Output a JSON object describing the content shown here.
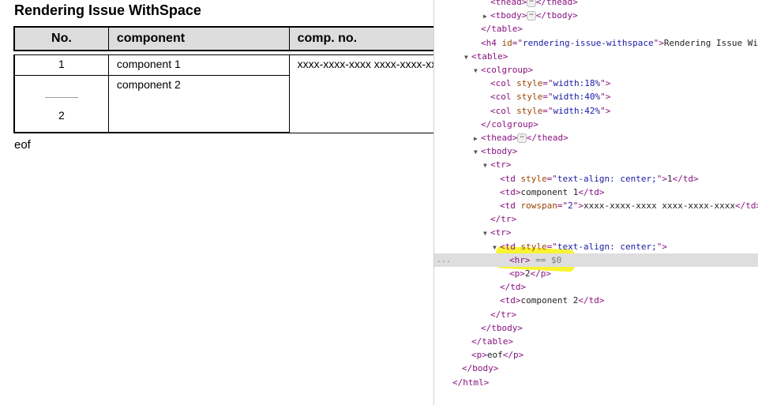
{
  "page": {
    "heading": "Rendering Issue WithSpace",
    "table": {
      "headers": [
        "No.",
        "component",
        "comp. no."
      ],
      "rows": [
        {
          "no": "1",
          "component": "component 1",
          "comp_no": "xxxx-xxxx-xxxx xxxx-xxxx-xxxx"
        },
        {
          "no": "2",
          "component": "component 2"
        }
      ]
    },
    "footer_text": "eof"
  },
  "devtools": {
    "lines": [
      {
        "indent": 3,
        "toggle": "",
        "parts": [
          [
            "tag",
            "<thead>"
          ],
          [
            "ellip",
            "⋯"
          ],
          [
            "tag",
            "</thead>"
          ]
        ],
        "partial": true
      },
      {
        "indent": 3,
        "toggle": "▶",
        "parts": [
          [
            "tag",
            "<tbody>"
          ],
          [
            "ellip",
            "⋯"
          ],
          [
            "tag",
            "</tbody>"
          ]
        ]
      },
      {
        "indent": 2,
        "toggle": "",
        "parts": [
          [
            "tag",
            "</table>"
          ]
        ]
      },
      {
        "indent": 2,
        "toggle": "",
        "parts": [
          [
            "tag",
            "<h4 "
          ],
          [
            "attr",
            "id"
          ],
          [
            "tag",
            "=\""
          ],
          [
            "val",
            "rendering-issue-withspace"
          ],
          [
            "tag",
            "\">"
          ],
          [
            "txt",
            "Rendering Issue WithSpace"
          ]
        ]
      },
      {
        "indent": 1,
        "toggle": "▼",
        "parts": [
          [
            "tag",
            "<table>"
          ]
        ]
      },
      {
        "indent": 2,
        "toggle": "▼",
        "parts": [
          [
            "tag",
            "<colgroup>"
          ]
        ]
      },
      {
        "indent": 3,
        "toggle": "",
        "parts": [
          [
            "tag",
            "<col "
          ],
          [
            "attr",
            "style"
          ],
          [
            "tag",
            "=\""
          ],
          [
            "val",
            "width:18%"
          ],
          [
            "tag",
            "\">"
          ]
        ]
      },
      {
        "indent": 3,
        "toggle": "",
        "parts": [
          [
            "tag",
            "<col "
          ],
          [
            "attr",
            "style"
          ],
          [
            "tag",
            "=\""
          ],
          [
            "val",
            "width:40%"
          ],
          [
            "tag",
            "\">"
          ]
        ]
      },
      {
        "indent": 3,
        "toggle": "",
        "parts": [
          [
            "tag",
            "<col "
          ],
          [
            "attr",
            "style"
          ],
          [
            "tag",
            "=\""
          ],
          [
            "val",
            "width:42%"
          ],
          [
            "tag",
            "\">"
          ]
        ]
      },
      {
        "indent": 2,
        "toggle": "",
        "parts": [
          [
            "tag",
            "</colgroup>"
          ]
        ]
      },
      {
        "indent": 2,
        "toggle": "▶",
        "parts": [
          [
            "tag",
            "<thead>"
          ],
          [
            "ellip",
            "⋯"
          ],
          [
            "tag",
            "</thead>"
          ]
        ]
      },
      {
        "indent": 2,
        "toggle": "▼",
        "parts": [
          [
            "tag",
            "<tbody>"
          ]
        ]
      },
      {
        "indent": 3,
        "toggle": "▼",
        "parts": [
          [
            "tag",
            "<tr>"
          ]
        ]
      },
      {
        "indent": 4,
        "toggle": "",
        "parts": [
          [
            "tag",
            "<td "
          ],
          [
            "attr",
            "style"
          ],
          [
            "tag",
            "=\""
          ],
          [
            "val",
            "text-align: center;"
          ],
          [
            "tag",
            "\">"
          ],
          [
            "txt",
            "1"
          ],
          [
            "tag",
            "</td>"
          ]
        ]
      },
      {
        "indent": 4,
        "toggle": "",
        "parts": [
          [
            "tag",
            "<td>"
          ],
          [
            "txt",
            "component 1"
          ],
          [
            "tag",
            "</td>"
          ]
        ]
      },
      {
        "indent": 4,
        "toggle": "",
        "parts": [
          [
            "tag",
            "<td "
          ],
          [
            "attr",
            "rowspan"
          ],
          [
            "tag",
            "=\""
          ],
          [
            "val",
            "2"
          ],
          [
            "tag",
            "\">"
          ],
          [
            "txt",
            "xxxx-xxxx-xxxx xxxx-xxxx-xxxx"
          ],
          [
            "tag",
            "</td>"
          ]
        ]
      },
      {
        "indent": 3,
        "toggle": "",
        "parts": [
          [
            "tag",
            "</tr>"
          ]
        ]
      },
      {
        "indent": 3,
        "toggle": "▼",
        "parts": [
          [
            "tag",
            "<tr>"
          ]
        ]
      },
      {
        "indent": 4,
        "toggle": "▼",
        "parts": [
          [
            "tag",
            "<td "
          ],
          [
            "attr",
            "style"
          ],
          [
            "tag",
            "=\""
          ],
          [
            "val",
            "text-align: center;"
          ],
          [
            "tag",
            "\">"
          ]
        ]
      },
      {
        "indent": 5,
        "toggle": "",
        "selected": true,
        "parts": [
          [
            "tag",
            "<hr>"
          ],
          [
            "eq",
            " == $0"
          ]
        ]
      },
      {
        "indent": 5,
        "toggle": "",
        "parts": [
          [
            "tag",
            "<p>"
          ],
          [
            "txt",
            "2"
          ],
          [
            "tag",
            "</p>"
          ]
        ]
      },
      {
        "indent": 4,
        "toggle": "",
        "parts": [
          [
            "tag",
            "</td>"
          ]
        ]
      },
      {
        "indent": 4,
        "toggle": "",
        "parts": [
          [
            "tag",
            "<td>"
          ],
          [
            "txt",
            "component 2"
          ],
          [
            "tag",
            "</td>"
          ]
        ]
      },
      {
        "indent": 3,
        "toggle": "",
        "parts": [
          [
            "tag",
            "</tr>"
          ]
        ]
      },
      {
        "indent": 2,
        "toggle": "",
        "parts": [
          [
            "tag",
            "</tbody>"
          ]
        ]
      },
      {
        "indent": 1,
        "toggle": "",
        "parts": [
          [
            "tag",
            "</table>"
          ]
        ]
      },
      {
        "indent": 1,
        "toggle": "",
        "parts": [
          [
            "tag",
            "<p>"
          ],
          [
            "txt",
            "eof"
          ],
          [
            "tag",
            "</p>"
          ]
        ]
      },
      {
        "indent": 0,
        "toggle": "",
        "parts": [
          [
            "tag",
            "</body>"
          ]
        ]
      },
      {
        "indent": -1,
        "toggle": "",
        "parts": [
          [
            "tag",
            "</html>"
          ]
        ]
      }
    ],
    "selected_marker": "...",
    "colors": {
      "tag": "#881280",
      "attr": "#994500",
      "value": "#1a1aa6",
      "highlight": "#f7f31c"
    }
  }
}
